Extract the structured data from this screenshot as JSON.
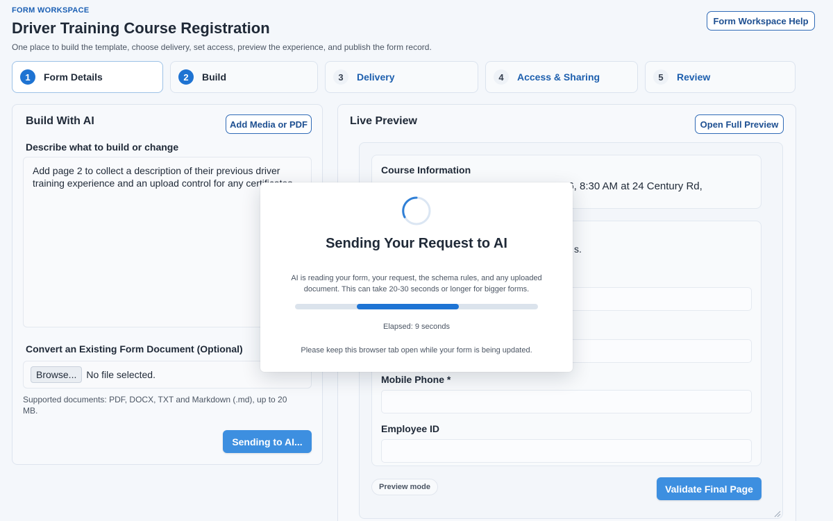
{
  "header": {
    "eyebrow": "FORM WORKSPACE",
    "title": "Driver Training Course Registration",
    "subtitle": "One place to build the template, choose delivery, set access, preview the experience, and publish the form record.",
    "help_label": "Form Workspace Help"
  },
  "steps": [
    {
      "num": "1",
      "label": "Form Details"
    },
    {
      "num": "2",
      "label": "Build"
    },
    {
      "num": "3",
      "label": "Delivery"
    },
    {
      "num": "4",
      "label": "Access & Sharing"
    },
    {
      "num": "5",
      "label": "Review"
    }
  ],
  "build_panel": {
    "title": "Build With AI",
    "add_media_label": "Add Media or PDF",
    "describe_label": "Describe what to build or change",
    "prompt_value": "Add page 2 to collect a description of their previous driver training experience and an upload control for any certificates.",
    "convert_label": "Convert an Existing Form Document (Optional)",
    "browse_label": "Browse...",
    "file_status": "No file selected.",
    "supported_text": "Supported documents: PDF, DOCX, TXT and Markdown (.md), up to 20 MB.",
    "send_label": "Sending to AI..."
  },
  "preview_panel": {
    "title": "Live Preview",
    "open_full_label": "Open Full Preview",
    "course_info_title": "Course Information",
    "course_info_partial": "26, 8:30 AM at 24 Century Rd,",
    "obscured_partial": "s.",
    "mobile_label": "Mobile Phone *",
    "employee_label": "Employee ID",
    "preview_mode_label": "Preview mode",
    "validate_label": "Validate Final Page"
  },
  "modal": {
    "title": "Sending Your Request to AI",
    "description": "AI is reading your form, your request, the schema rules, and any uploaded document. This can take 20-30 seconds or longer for bigger forms.",
    "elapsed": "Elapsed: 9 seconds",
    "note": "Please keep this browser tab open while your form is being updated.",
    "progress_start": 0.255,
    "progress_end": 0.675
  },
  "colors": {
    "accent": "#1e73d2",
    "primary_button": "#3d8fe0",
    "brand_text": "#1a5fb4"
  }
}
